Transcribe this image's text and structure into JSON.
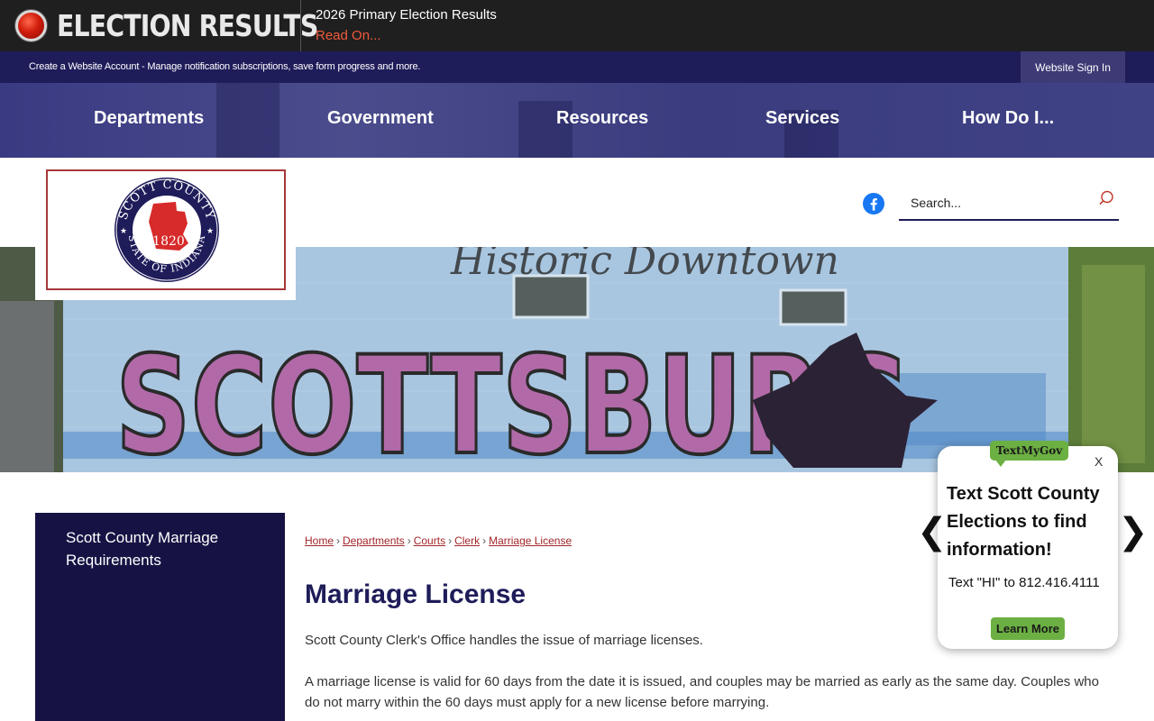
{
  "alert": {
    "title": "ELECTION RESULTS",
    "headline": "2026 Primary Election Results",
    "read_on": "Read On..."
  },
  "account_bar": {
    "text": "Create a Website Account - Manage notification subscriptions, save form progress and more.",
    "sign_in": "Website Sign In"
  },
  "nav": {
    "items": [
      "Departments",
      "Government",
      "Resources",
      "Services",
      "How Do I..."
    ]
  },
  "logo": {
    "seal_top_text": "SCOTT COUNTY",
    "seal_bottom_text": "STATE OF INDIANA",
    "seal_year": "1820",
    "seal_color": "#1f1c5a",
    "map_color": "#d72a2a"
  },
  "social": {
    "icon": "facebook-icon"
  },
  "search": {
    "placeholder": "Search..."
  },
  "banner": {
    "text": "SCOTTSBURG",
    "script_text": "Historic Downtown"
  },
  "sidebar": {
    "items": [
      "Scott County Marriage Requirements"
    ]
  },
  "breadcrumb": [
    "Home",
    "Departments",
    "Courts",
    "Clerk",
    "Marriage License"
  ],
  "content": {
    "title": "Marriage License",
    "paragraph1": "Scott County Clerk's Office handles the issue of marriage licenses.",
    "paragraph2": "A marriage license is valid for 60 days from the date it is issued, and couples may be married as early as the same day. Couples who do not marry within the 60 days must apply for a new license before marrying."
  },
  "textmygov": {
    "tag": "TextMyGov",
    "close": "X",
    "heading": "Text Scott County Elections to find information!",
    "body": "Text \"HI\" to 812.416.4111",
    "button": "Learn More",
    "prev": "❮",
    "next": "❯"
  },
  "colors": {
    "navy": "#1f1c5a",
    "sidebar": "#161344",
    "link_red": "#a3262a",
    "alert_red": "#ef5a3a",
    "tmg_green": "#6cb043"
  }
}
